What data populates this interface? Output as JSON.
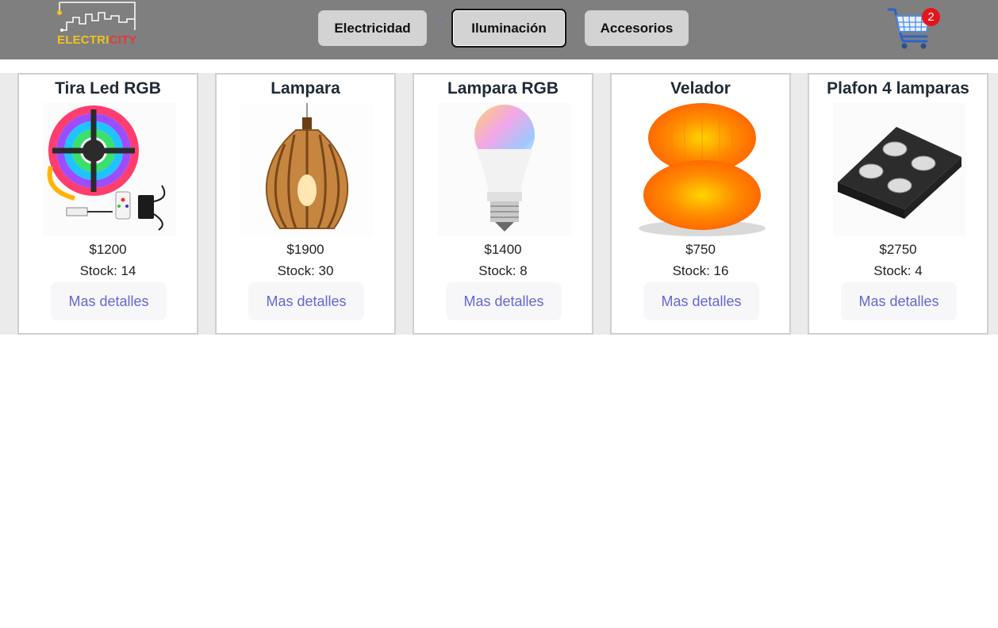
{
  "header": {
    "logo": {
      "text_part1": "ELECTRI",
      "text_part2": "CITY",
      "icon": "city-skyline-logo-icon"
    },
    "nav": [
      {
        "label": "Electricidad",
        "active": false
      },
      {
        "label": "Iluminación",
        "active": true
      },
      {
        "label": "Accesorios",
        "active": false
      }
    ],
    "cart": {
      "icon": "shopping-cart-icon",
      "count": "2"
    }
  },
  "products": [
    {
      "title": "Tira Led RGB",
      "price": "$1200",
      "stock": "Stock: 14",
      "button": "Mas detalles",
      "image": "led-strip-image"
    },
    {
      "title": "Lampara",
      "price": "$1900",
      "stock": "Stock: 30",
      "button": "Mas detalles",
      "image": "wooden-pendant-lamp-image"
    },
    {
      "title": "Lampara RGB",
      "price": "$1400",
      "stock": "Stock: 8",
      "button": "Mas detalles",
      "image": "rgb-bulb-image"
    },
    {
      "title": "Velador",
      "price": "$750",
      "stock": "Stock: 16",
      "button": "Mas detalles",
      "image": "orange-table-lamp-image"
    },
    {
      "title": "Plafon 4 lamparas",
      "price": "$2750",
      "stock": "Stock: 4",
      "button": "Mas detalles",
      "image": "ceiling-spotlight-image"
    }
  ],
  "colors": {
    "navbar": "#7f7f7f",
    "button_bg": "#d3d3d3",
    "link": "#6466d4",
    "badge": "#e8141c"
  }
}
